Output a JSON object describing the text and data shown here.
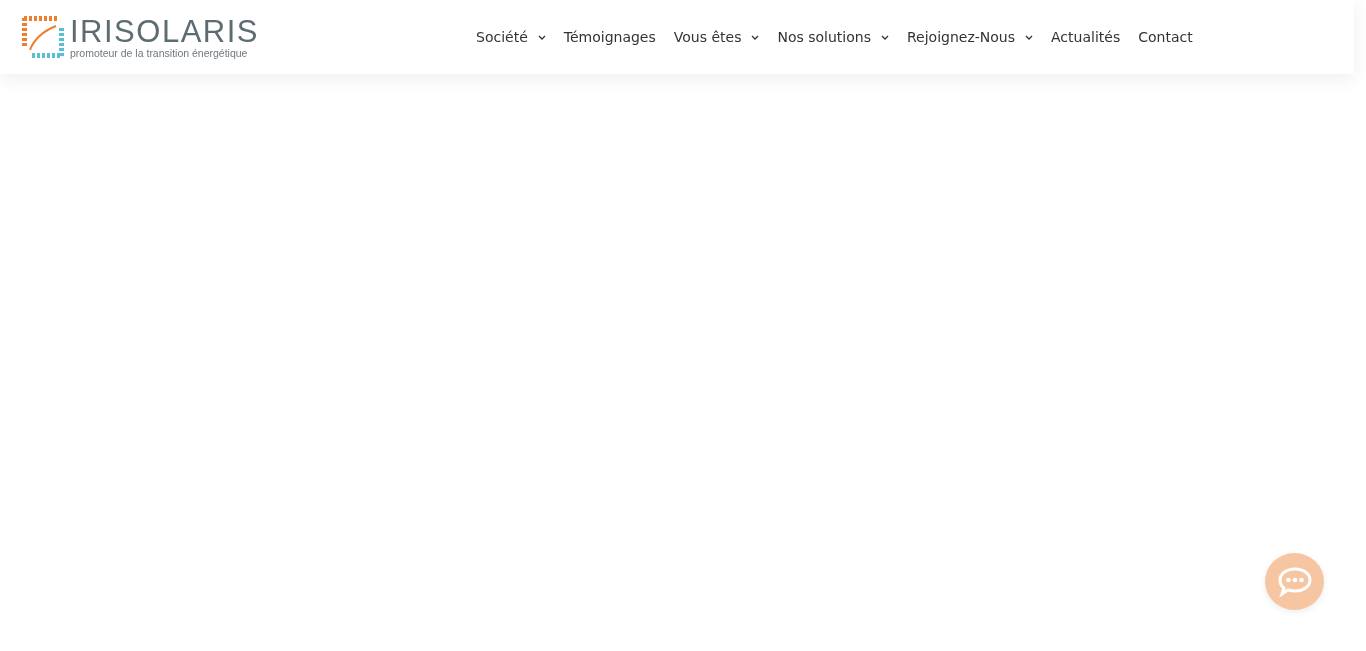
{
  "logo": {
    "name": "IRISOLARIS",
    "tagline": "promoteur de la transition énergétique"
  },
  "nav": [
    {
      "label": "Société",
      "dropdown": true
    },
    {
      "label": "Témoignages",
      "dropdown": false
    },
    {
      "label": "Vous êtes",
      "dropdown": true
    },
    {
      "label": "Nos solutions",
      "dropdown": true
    },
    {
      "label": "Rejoignez-Nous",
      "dropdown": true
    },
    {
      "label": "Actualités",
      "dropdown": false
    },
    {
      "label": "Contact",
      "dropdown": false
    }
  ]
}
